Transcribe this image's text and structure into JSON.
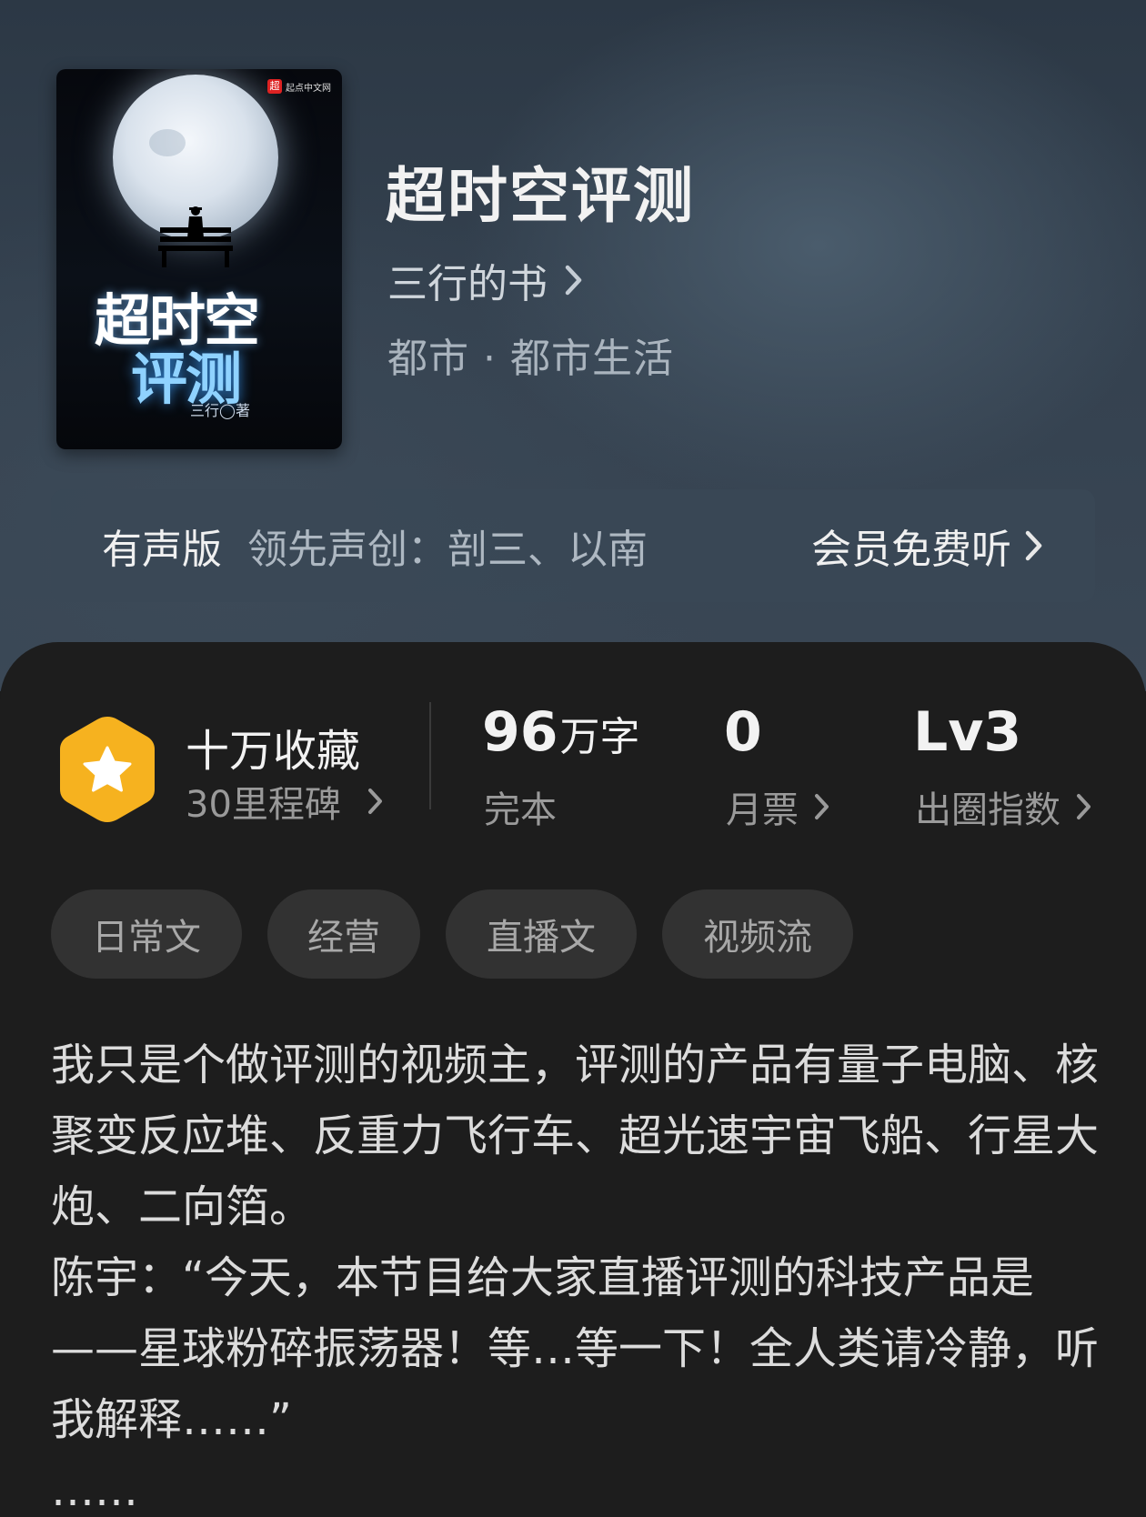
{
  "cover": {
    "badge_text": "起点中文网",
    "badge_logo": "超",
    "title_line1": "超时空",
    "title_line2": "评测",
    "author_text": "三行◯著"
  },
  "book": {
    "title": "超时空评测",
    "author": "三行的书",
    "genre": "都市 · 都市生活"
  },
  "audio": {
    "label": "有声版",
    "description": "领先声创：剖三、以南",
    "cta": "会员免费听"
  },
  "stats": {
    "collect_title": "十万收藏",
    "collect_sub": "30里程碑",
    "words_value": "96",
    "words_unit": "万字",
    "words_label": "完本",
    "tickets_value": "0",
    "tickets_label": "月票",
    "index_value": "Lv3",
    "index_label": "出圈指数"
  },
  "tags": [
    "日常文",
    "经营",
    "直播文",
    "视频流"
  ],
  "synopsis": "我只是个做评测的视频主，评测的产品有量子电脑、核聚变反应堆、反重力飞行车、超光速宇宙飞船、行星大炮、二向箔。\n陈宇：“今天，本节目给大家直播评测的科技产品是——星球粉碎振荡器！等…等一下！全人类请冷静，听我解释……”\n……",
  "colors": {
    "hero_bg": "#34414f",
    "content_bg": "#1d1d1d",
    "hexagon": "#f6b21f",
    "tag_bg": "#323232"
  },
  "icons": {
    "collect": "star-hexagon-icon",
    "chevron": "chevron-right-icon"
  }
}
